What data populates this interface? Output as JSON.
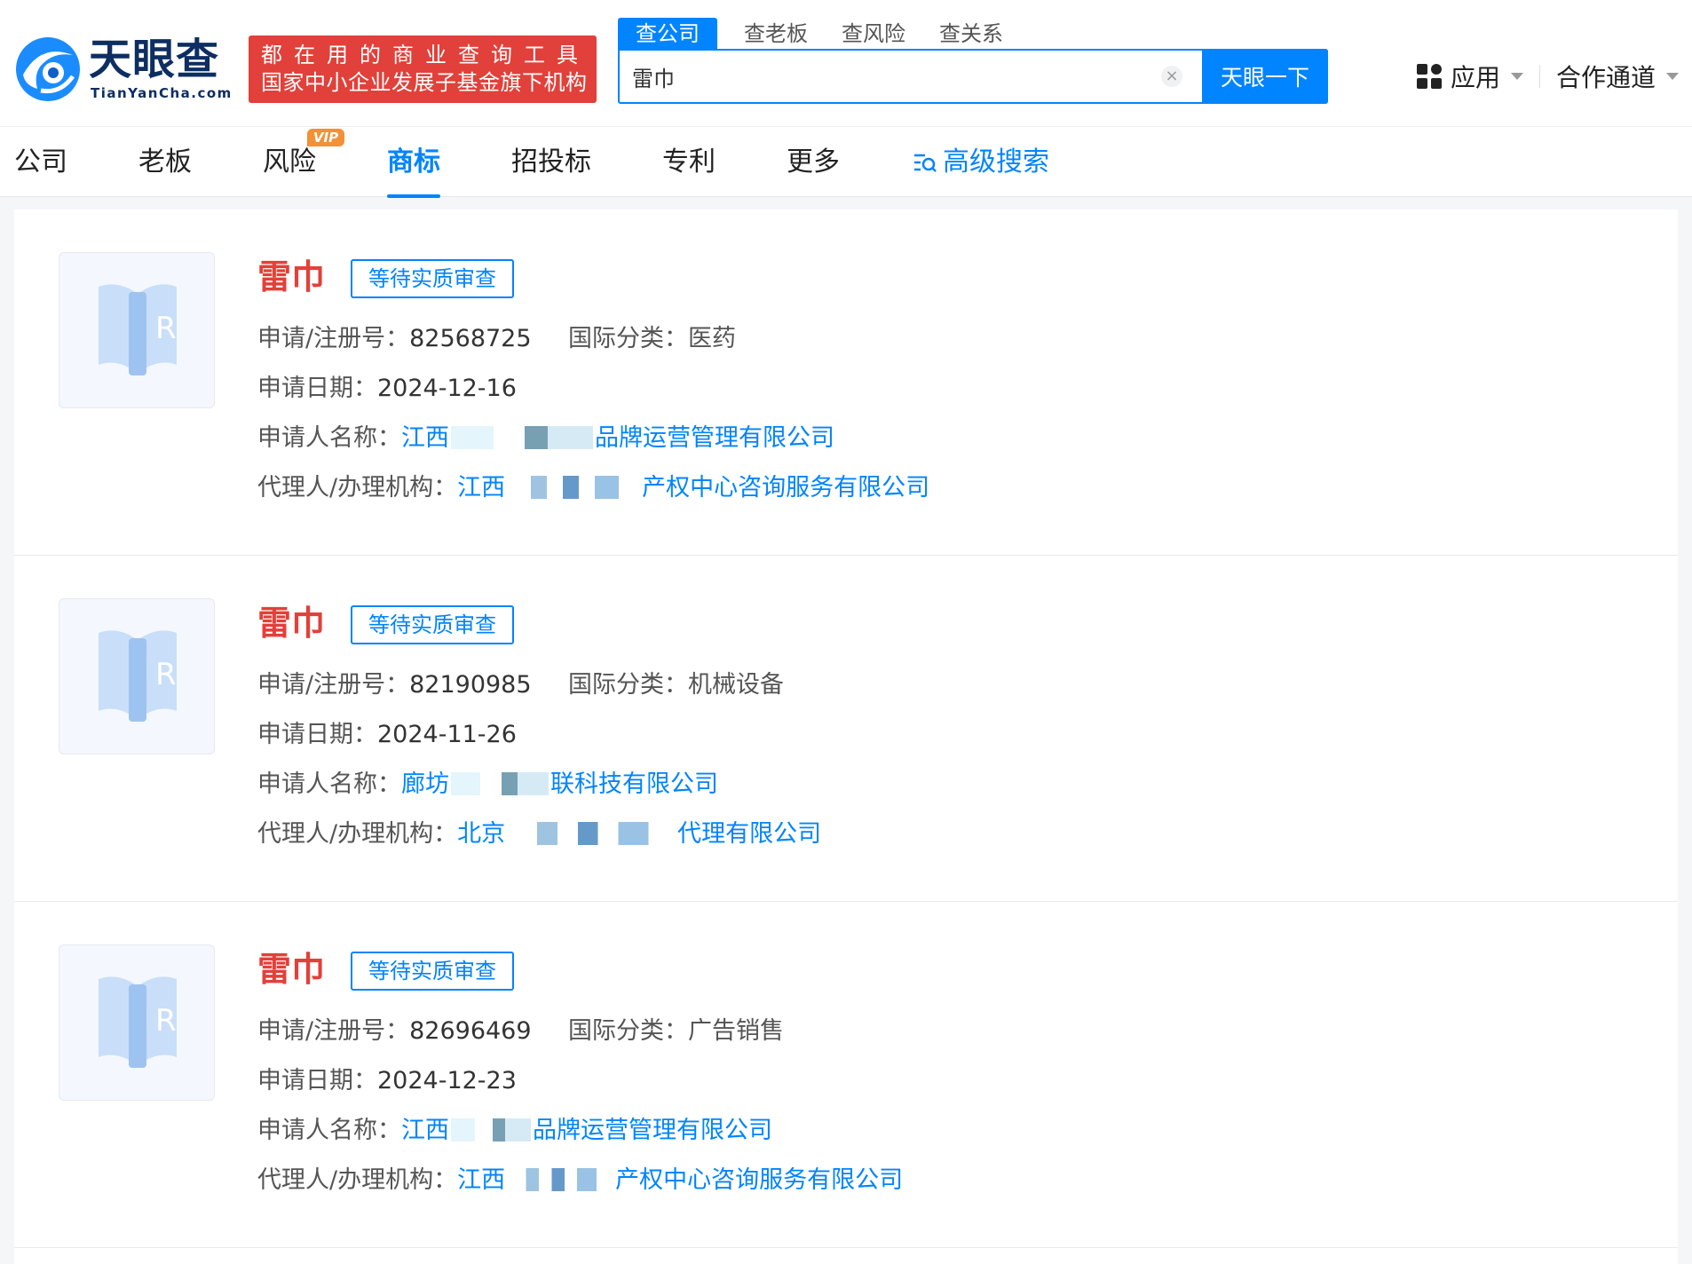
{
  "brand": {
    "name": "天眼查",
    "domain": "TianYanCha.com",
    "slogan_line1": "都在用的商业查询工具",
    "slogan_line2": "国家中小企业发展子基金旗下机构",
    "colors": {
      "primary": "#0084ff",
      "accent": "#e2403a",
      "vip": "#f29135"
    }
  },
  "search": {
    "tabs": [
      "查公司",
      "查老板",
      "查风险",
      "查关系"
    ],
    "active_tab": 0,
    "value": "雷巾",
    "button_label": "天眼一下"
  },
  "top_links": {
    "apps": "应用",
    "partner": "合作通道"
  },
  "nav": {
    "items": [
      "公司",
      "老板",
      "风险",
      "商标",
      "招投标",
      "专利",
      "更多"
    ],
    "active_index": 3,
    "vip_badge": "VIP",
    "advanced_search": "高级搜索"
  },
  "labels": {
    "reg_no": "申请/注册号：",
    "intl_class": "国际分类：",
    "apply_date": "申请日期：",
    "applicant": "申请人名称：",
    "agent": "代理人/办理机构："
  },
  "results": [
    {
      "name": "雷巾",
      "status": "等待实质审查",
      "reg_no": "82568725",
      "intl_class": "医药",
      "apply_date": "2024-12-16",
      "applicant_pre": "江西",
      "applicant_post": "品牌运营管理有限公司",
      "agent_pre": "江西",
      "agent_post": "产权中心咨询服务有限公司"
    },
    {
      "name": "雷巾",
      "status": "等待实质审查",
      "reg_no": "82190985",
      "intl_class": "机械设备",
      "apply_date": "2024-11-26",
      "applicant_pre": "廊坊",
      "applicant_post": "联科技有限公司",
      "agent_pre": "北京",
      "agent_post": "代理有限公司"
    },
    {
      "name": "雷巾",
      "status": "等待实质审查",
      "reg_no": "82696469",
      "intl_class": "广告销售",
      "apply_date": "2024-12-23",
      "applicant_pre": "江西",
      "applicant_post": "品牌运营管理有限公司",
      "agent_pre": "江西",
      "agent_post": "产权中心咨询服务有限公司"
    }
  ]
}
